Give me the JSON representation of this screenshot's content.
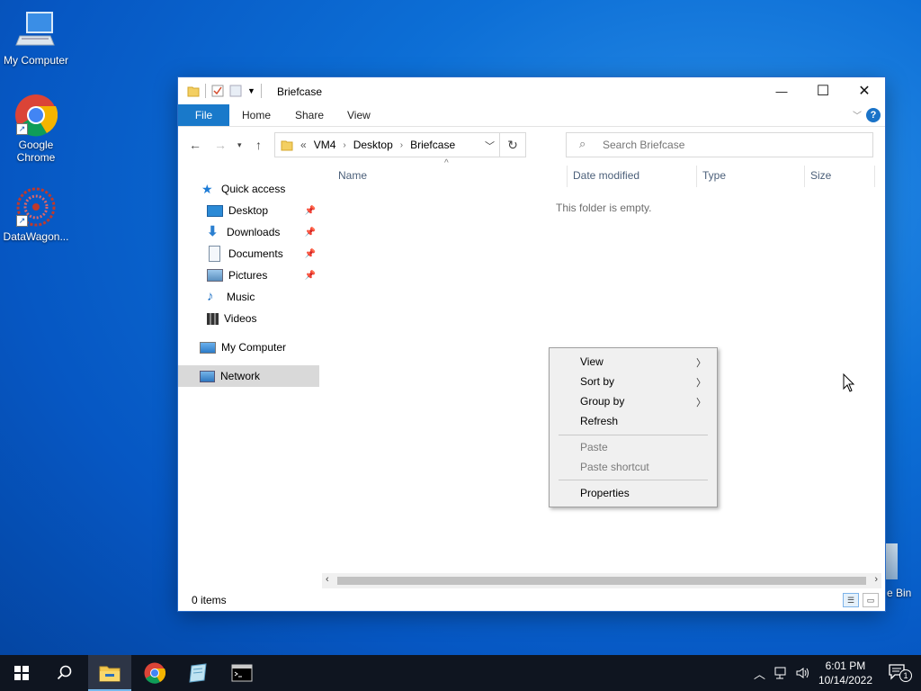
{
  "desktop": {
    "icons": [
      {
        "label": "My Computer"
      },
      {
        "label": "Google Chrome"
      },
      {
        "label": "DataWagon..."
      }
    ],
    "recycle_label": "e Bin"
  },
  "window": {
    "title": "Briefcase",
    "controls": {
      "minimize": "—",
      "maximize": "☐",
      "close": "✕"
    },
    "ribbon_tabs": [
      "File",
      "Home",
      "Share",
      "View"
    ],
    "help": "?",
    "address": {
      "overflow": "«",
      "crumbs": [
        "VM4",
        "Desktop",
        "Briefcase"
      ]
    },
    "search_placeholder": "Search Briefcase",
    "nav_pane": {
      "quick_access": "Quick access",
      "pinned": [
        {
          "label": "Desktop"
        },
        {
          "label": "Downloads"
        },
        {
          "label": "Documents"
        },
        {
          "label": "Pictures"
        }
      ],
      "items": [
        {
          "label": "Music"
        },
        {
          "label": "Videos"
        }
      ],
      "my_computer": "My Computer",
      "network": "Network"
    },
    "columns": [
      "Name",
      "Date modified",
      "Type",
      "Size"
    ],
    "empty_message": "This folder is empty.",
    "status": "0 items"
  },
  "context_menu": {
    "items": [
      {
        "label": "View",
        "submenu": true,
        "disabled": false
      },
      {
        "label": "Sort by",
        "submenu": true,
        "disabled": false
      },
      {
        "label": "Group by",
        "submenu": true,
        "disabled": false
      },
      {
        "label": "Refresh",
        "submenu": false,
        "disabled": false
      },
      {
        "label": "Paste",
        "submenu": false,
        "disabled": true
      },
      {
        "label": "Paste shortcut",
        "submenu": false,
        "disabled": true
      },
      {
        "label": "Properties",
        "submenu": false,
        "disabled": false
      }
    ]
  },
  "taskbar": {
    "time": "6:01 PM",
    "date": "10/14/2022",
    "notification_count": "1"
  },
  "colors": {
    "accent": "#1979ca",
    "taskbar": "#0f1520",
    "selected": "#d9d9d9"
  }
}
